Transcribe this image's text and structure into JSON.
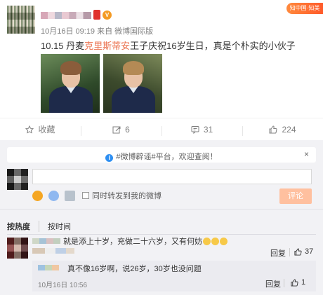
{
  "post": {
    "badge_label": "V",
    "fold_tag": "知中国·知美",
    "meta": "10月16日 09:19 来自 微博国际版",
    "content_prefix": "10.15 丹麦",
    "content_highlight": "克里斯蒂安",
    "content_suffix": "王子庆祝16岁生日，真是个朴实的小伙子"
  },
  "actions": {
    "favorite_label": "收藏",
    "repost_count": "6",
    "comment_count": "31",
    "like_count": "224"
  },
  "comment_box": {
    "notice_text": "#微博辟谣#平台，欢迎查阅！",
    "close_label": "×",
    "forward_label": "同时转发到我的微博",
    "submit_label": "评论"
  },
  "sort": {
    "by_hot": "按热度",
    "by_time": "按时间"
  },
  "comments": [
    {
      "text": "就是添上十岁，充做二十六岁，又有何妨",
      "reply_label": "回复",
      "likes": "37",
      "replies": [
        {
          "text": "真不像16岁啊，说26岁，30岁也没问题",
          "time": "10月16日 10:56",
          "reply_label": "回复",
          "likes": "1"
        }
      ]
    }
  ],
  "colors": {
    "accent": "#eb7350",
    "link": "#2e8ff2",
    "submit_disabled": "#ffc09f",
    "panel_bg": "#f2f2f5"
  },
  "icons": {
    "favorite": "star-icon",
    "repost": "repost-icon",
    "comment": "comment-icon",
    "like": "thumbs-up-icon"
  }
}
